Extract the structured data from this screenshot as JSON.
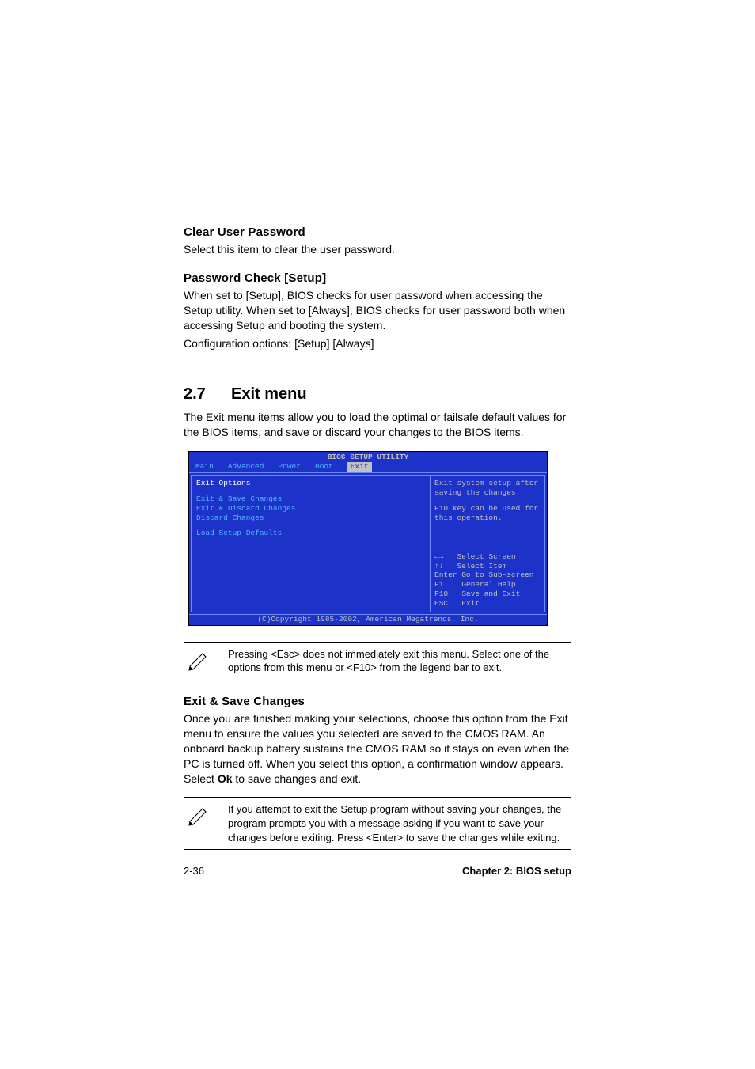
{
  "section1": {
    "heading": "Clear User Password",
    "text": "Select this item to clear the user password."
  },
  "section2": {
    "heading": "Password Check [Setup]",
    "text1": "When set to [Setup], BIOS checks for user password when accessing the Setup utility. When set to [Always], BIOS checks for user password both when accessing Setup and booting the system.",
    "text2": "Configuration options: [Setup] [Always]"
  },
  "section3": {
    "num": "2.7",
    "title": "Exit menu",
    "intro": "The Exit menu items allow you to load the optimal or failsafe default values for the BIOS items, and save or discard your changes to the BIOS items."
  },
  "bios": {
    "title": "BIOS SETUP UTILITY",
    "tabs": {
      "t1": "Main",
      "t2": "Advanced",
      "t3": "Power",
      "t4": "Boot",
      "t5": "Exit"
    },
    "left": {
      "hdr": "Exit Options",
      "i1": "Exit & Save Changes",
      "i2": "Exit & Discard Changes",
      "i3": "Discard Changes",
      "i4": "Load Setup Defaults"
    },
    "right": {
      "help1": "Exit system setup after saving the changes.",
      "help2": "F10 key can be used for this operation.",
      "nav1": "←→   Select Screen",
      "nav2": "↑↓   Select Item",
      "nav3": "Enter Go to Sub-screen",
      "nav4": "F1    General Help",
      "nav5": "F10   Save and Exit",
      "nav6": "ESC   Exit"
    },
    "footer": "(C)Copyright 1985-2002, American Megatrends, Inc."
  },
  "note1": "Pressing <Esc> does not immediately exit this menu. Select one of the options from this menu or <F10> from the legend bar to exit.",
  "section4": {
    "heading": "Exit & Save Changes",
    "text_a": "Once you are finished making your selections, choose this option from the Exit menu to ensure the values you selected are saved to the CMOS RAM. An onboard backup battery sustains the CMOS RAM so it stays on even when the PC is turned off. When you select this option, a confirmation window appears. Select ",
    "ok": "Ok",
    "text_b": " to save changes and exit."
  },
  "note2": "If you attempt to exit the Setup program without saving your changes, the program prompts you with a message asking if you want to save your changes before exiting. Press <Enter>  to save the  changes while exiting.",
  "footer": {
    "page": "2-36",
    "chapter": "Chapter 2: BIOS setup"
  }
}
